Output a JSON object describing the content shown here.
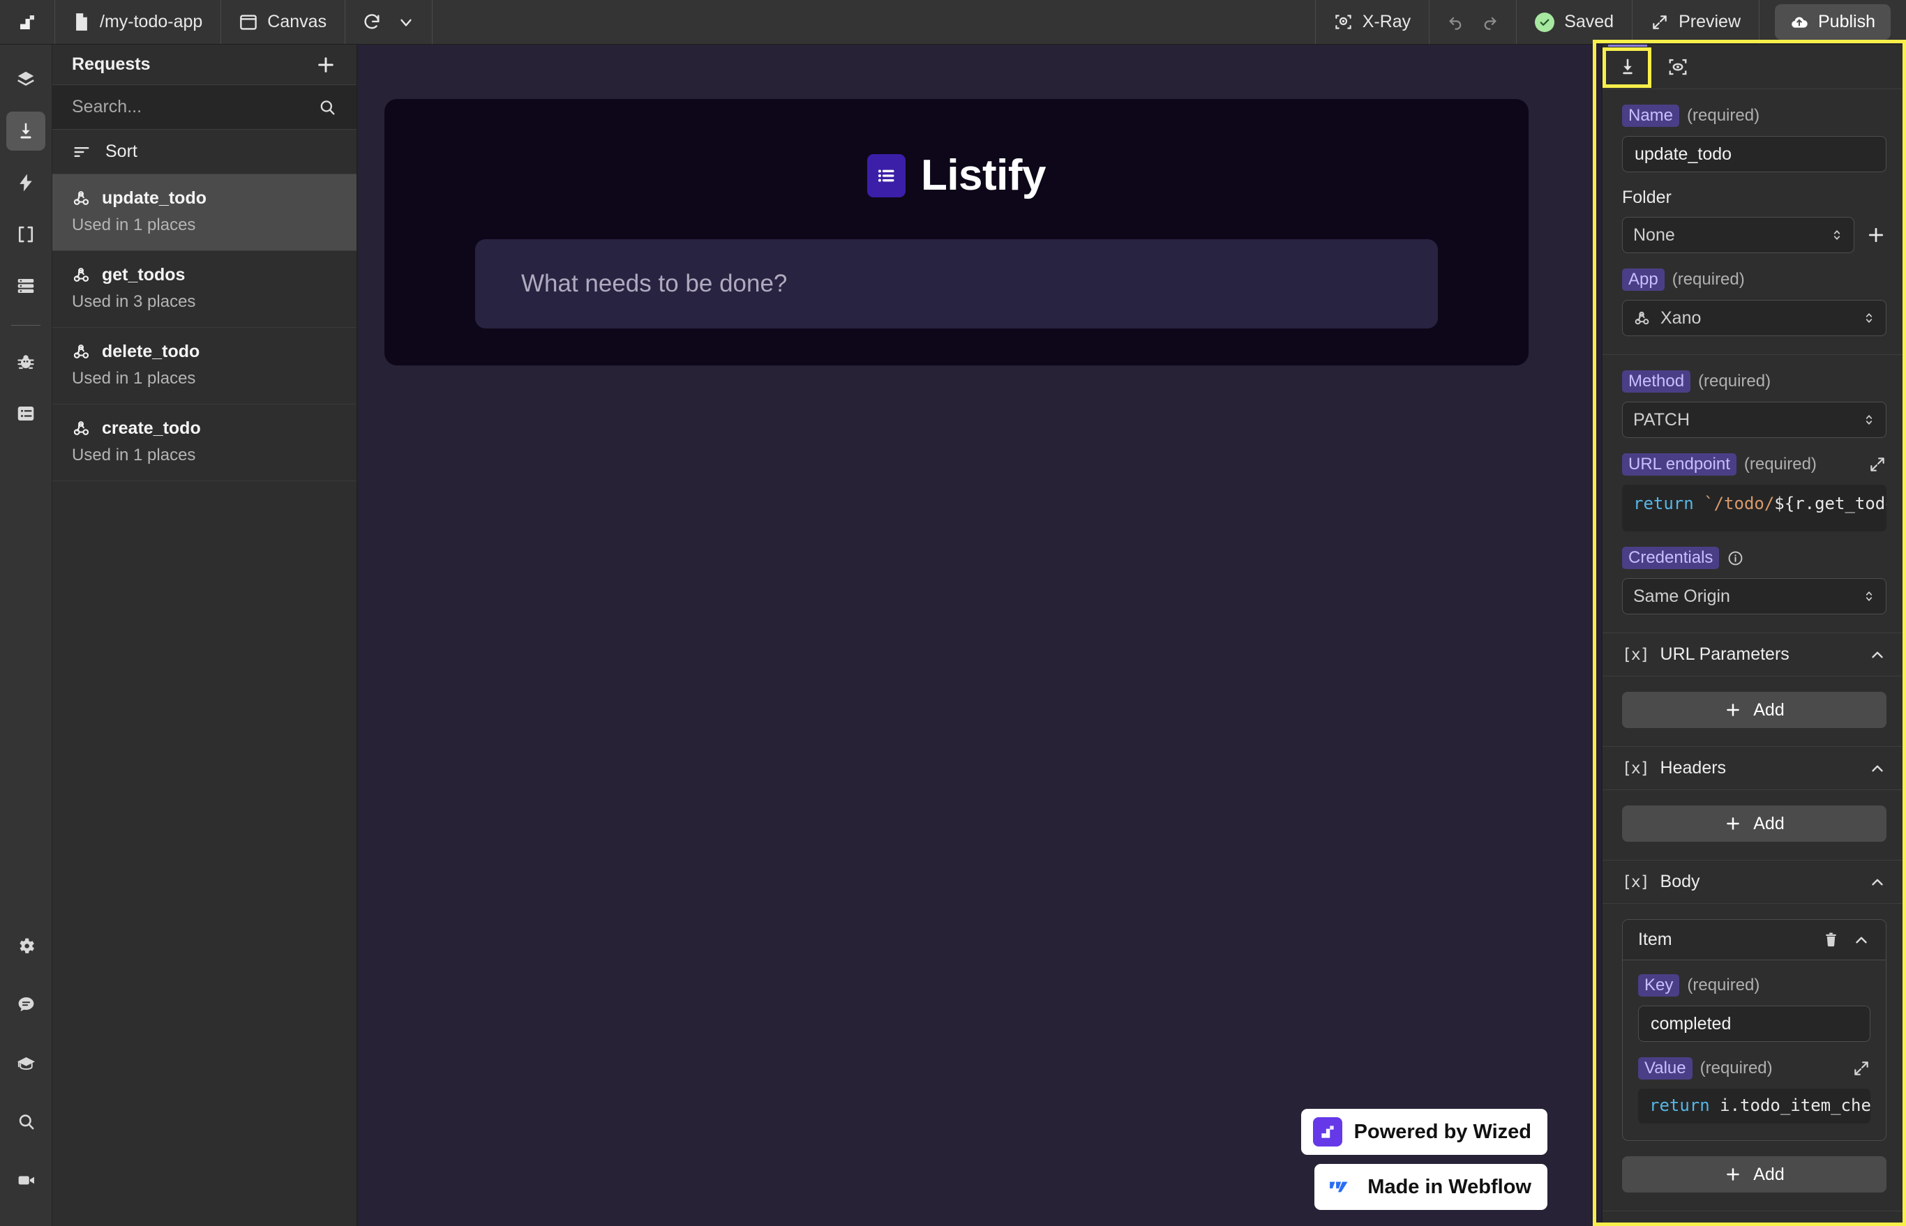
{
  "topbar": {
    "logo_icon": "wized-logo-icon",
    "project_path": "/my-todo-app",
    "page_tab": "Canvas",
    "xray_label": "X-Ray",
    "saved_label": "Saved",
    "preview_label": "Preview",
    "publish_label": "Publish"
  },
  "rail": {
    "items": [
      {
        "icon": "layers-icon",
        "active": false
      },
      {
        "icon": "requests-upload-icon",
        "active": true
      },
      {
        "icon": "lightning-bolt-icon",
        "active": false
      },
      {
        "icon": "brackets-variable-icon",
        "active": false
      },
      {
        "icon": "database-icon",
        "active": false
      }
    ],
    "bottom_items": [
      {
        "icon": "bug-icon"
      },
      {
        "icon": "logs-list-icon"
      }
    ],
    "footer_items": [
      {
        "icon": "gear-icon"
      },
      {
        "icon": "chat-bubble-icon"
      },
      {
        "icon": "graduation-cap-icon"
      },
      {
        "icon": "search-icon"
      },
      {
        "icon": "video-camera-icon"
      }
    ]
  },
  "requests": {
    "title": "Requests",
    "add_icon": "plus-icon",
    "search_placeholder": "Search...",
    "search_value": "",
    "search_icon": "search-icon",
    "sort_label": "Sort",
    "sort_icon": "sort-icon",
    "items": [
      {
        "name": "update_todo",
        "usage": "Used in 1 places",
        "icon": "webhook-icon",
        "selected": true
      },
      {
        "name": "get_todos",
        "usage": "Used in 3 places",
        "icon": "webhook-icon",
        "selected": false
      },
      {
        "name": "delete_todo",
        "usage": "Used in 1 places",
        "icon": "webhook-icon",
        "selected": false
      },
      {
        "name": "create_todo",
        "usage": "Used in 1 places",
        "icon": "webhook-icon",
        "selected": false
      }
    ]
  },
  "canvas": {
    "app_name": "Listify",
    "logo_icon": "list-icon",
    "todo_placeholder": "What needs to be done?",
    "badges": [
      {
        "label": "Powered by Wized",
        "icon": "wized-logo-icon"
      },
      {
        "label": "Made in Webflow",
        "icon": "webflow-logo-icon"
      }
    ]
  },
  "inspector": {
    "tabs": [
      {
        "icon": "request-config-icon",
        "active": true
      },
      {
        "icon": "response-preview-icon",
        "active": false
      }
    ],
    "name_field": {
      "label": "Name",
      "required": "(required)",
      "value": "update_todo"
    },
    "folder_field": {
      "label": "Folder",
      "value": "None",
      "add_icon": "plus-icon"
    },
    "app_field": {
      "label": "App",
      "required": "(required)",
      "value": "Xano",
      "icon": "webhook-icon"
    },
    "method_field": {
      "label": "Method",
      "required": "(required)",
      "value": "PATCH"
    },
    "url_field": {
      "label": "URL endpoint",
      "required": "(required)",
      "expand_icon": "expand-icon",
      "code_kw": "return",
      "code_str": " `/todo/",
      "code_rest": "${r.get_todos.da"
    },
    "credentials_field": {
      "label": "Credentials",
      "info_icon": "info-icon",
      "value": "Same Origin"
    },
    "sections": [
      {
        "title": "URL Parameters",
        "icon": "variable-brackets-icon",
        "chevron": "chevron-up-icon",
        "add_label": "Add"
      },
      {
        "title": "Headers",
        "icon": "variable-brackets-icon",
        "chevron": "chevron-up-icon",
        "add_label": "Add"
      }
    ],
    "body_section": {
      "title": "Body",
      "icon": "variable-brackets-icon",
      "chevron": "chevron-up-icon",
      "add_label": "Add",
      "item": {
        "title": "Item",
        "delete_icon": "trash-icon",
        "chevron": "chevron-up-icon",
        "key_label": "Key",
        "key_required": "(required)",
        "key_value": "completed",
        "value_label": "Value",
        "value_required": "(required)",
        "value_expand_icon": "expand-icon",
        "value_code_kw": "return",
        "value_code_rest": " i.todo_item_checkbo"
      }
    }
  },
  "colors": {
    "accent_purple": "#6539e8",
    "chip_bg": "#4a3f86",
    "chip_text": "#c8beff",
    "highlight_yellow": "#f7ef4a",
    "canvas_bg": "#272235",
    "site_bg": "#0d0719",
    "tab_indicator": "#8b7de0"
  }
}
